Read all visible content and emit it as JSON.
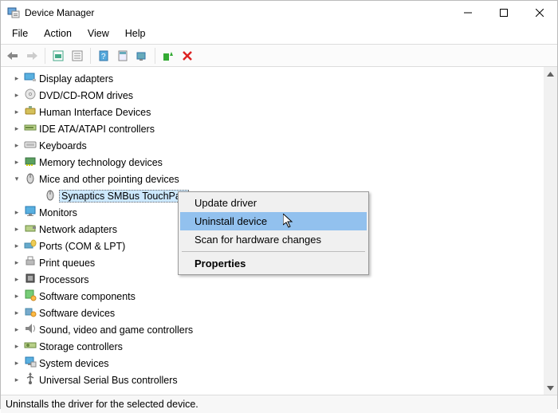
{
  "titlebar": {
    "title": "Device Manager"
  },
  "menubar": {
    "items": [
      "File",
      "Action",
      "View",
      "Help"
    ]
  },
  "tree": {
    "items": [
      {
        "label": "Display adapters",
        "icon": "monitor-card",
        "expanded": false
      },
      {
        "label": "DVD/CD-ROM drives",
        "icon": "disc",
        "expanded": false
      },
      {
        "label": "Human Interface Devices",
        "icon": "hid",
        "expanded": false
      },
      {
        "label": "IDE ATA/ATAPI controllers",
        "icon": "ide",
        "expanded": false
      },
      {
        "label": "Keyboards",
        "icon": "keyboard",
        "expanded": false
      },
      {
        "label": "Memory technology devices",
        "icon": "memory",
        "expanded": false
      },
      {
        "label": "Mice and other pointing devices",
        "icon": "mouse",
        "expanded": true,
        "children": [
          {
            "label": "Synaptics SMBus TouchPad",
            "icon": "mouse",
            "selected": true
          }
        ]
      },
      {
        "label": "Monitors",
        "icon": "monitor",
        "expanded": false
      },
      {
        "label": "Network adapters",
        "icon": "network",
        "expanded": false
      },
      {
        "label": "Ports (COM & LPT)",
        "icon": "ports",
        "expanded": false
      },
      {
        "label": "Print queues",
        "icon": "printer",
        "expanded": false
      },
      {
        "label": "Processors",
        "icon": "cpu",
        "expanded": false
      },
      {
        "label": "Software components",
        "icon": "software-comp",
        "expanded": false
      },
      {
        "label": "Software devices",
        "icon": "software-dev",
        "expanded": false
      },
      {
        "label": "Sound, video and game controllers",
        "icon": "sound",
        "expanded": false
      },
      {
        "label": "Storage controllers",
        "icon": "storage",
        "expanded": false
      },
      {
        "label": "System devices",
        "icon": "system",
        "expanded": false
      },
      {
        "label": "Universal Serial Bus controllers",
        "icon": "usb",
        "expanded": false
      }
    ]
  },
  "context_menu": {
    "items": [
      {
        "label": "Update driver",
        "highlighted": false
      },
      {
        "label": "Uninstall device",
        "highlighted": true
      },
      {
        "label": "Scan for hardware changes",
        "highlighted": false
      },
      {
        "label": "Properties",
        "highlighted": false,
        "bold": true
      }
    ]
  },
  "statusbar": {
    "text": "Uninstalls the driver for the selected device."
  }
}
